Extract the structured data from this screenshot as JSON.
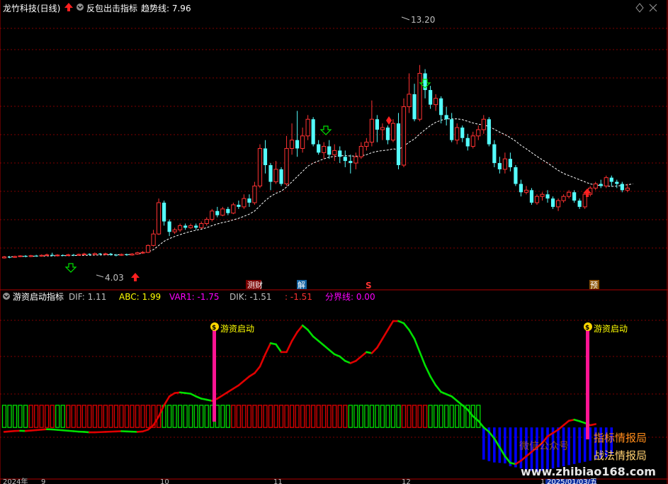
{
  "colors": {
    "up": "#ff3232",
    "down": "#54fcfc",
    "grid": "#800000",
    "border": "#b00000",
    "ma": "#ffffff",
    "green": "#00e000",
    "red": "#e00000",
    "blue": "#0000ff",
    "magenta": "#ff00ff",
    "yellow": "#ffff00",
    "label": "#c0c0c0",
    "watermark": "#ff8c1a"
  },
  "price_panel": {
    "stock_title": "龙竹科技(日线)",
    "indicator_name": "反包出击指标",
    "trend_label": "趋势线: 7.96",
    "max_label": "13.20",
    "min_label": "4.03",
    "markers": [
      "测财",
      "解",
      "S",
      "预"
    ]
  },
  "chart_data": {
    "type": "candlestick",
    "ylim": [
      3,
      15.5
    ],
    "max_price": 13.2,
    "min_price": 4.03,
    "trend_value": 7.96,
    "candles": [
      [
        3.95,
        4.0,
        3.92,
        4.05
      ],
      [
        4.0,
        3.98,
        3.94,
        4.04
      ],
      [
        3.98,
        4.02,
        3.95,
        4.06
      ],
      [
        4.02,
        4.05,
        3.99,
        4.08
      ],
      [
        4.05,
        4.02,
        3.98,
        4.09
      ],
      [
        4.02,
        4.06,
        3.99,
        4.1
      ],
      [
        4.06,
        4.04,
        4.0,
        4.1
      ],
      [
        4.04,
        4.08,
        4.01,
        4.12
      ],
      [
        4.08,
        4.1,
        4.04,
        4.16
      ],
      [
        4.1,
        4.06,
        4.03,
        4.2
      ],
      [
        4.06,
        4.09,
        4.02,
        4.13
      ],
      [
        4.09,
        4.07,
        4.03,
        4.12
      ],
      [
        4.07,
        4.1,
        4.04,
        4.15
      ],
      [
        4.1,
        4.08,
        4.04,
        4.14
      ],
      [
        4.08,
        4.12,
        4.05,
        4.16
      ],
      [
        4.12,
        4.14,
        4.08,
        4.2
      ],
      [
        4.14,
        4.11,
        4.07,
        4.17
      ],
      [
        4.11,
        4.16,
        4.09,
        4.21
      ],
      [
        4.16,
        4.13,
        4.08,
        4.19
      ],
      [
        4.13,
        4.15,
        4.09,
        4.2
      ],
      [
        4.15,
        4.1,
        4.06,
        4.19
      ],
      [
        4.1,
        4.08,
        4.03,
        4.14
      ],
      [
        4.08,
        4.12,
        4.05,
        4.16
      ],
      [
        4.12,
        4.09,
        4.05,
        4.16
      ],
      [
        4.09,
        4.14,
        4.06,
        4.18
      ],
      [
        4.14,
        4.2,
        4.1,
        4.25
      ],
      [
        4.2,
        4.22,
        4.15,
        4.28
      ],
      [
        4.22,
        4.55,
        4.18,
        4.6
      ],
      [
        4.55,
        5.1,
        4.5,
        5.3
      ],
      [
        5.1,
        6.6,
        5.05,
        6.8
      ],
      [
        6.6,
        5.7,
        5.5,
        6.7
      ],
      [
        5.7,
        5.2,
        5.0,
        5.8
      ],
      [
        5.2,
        5.3,
        5.1,
        5.4
      ],
      [
        5.3,
        5.5,
        5.2,
        5.6
      ],
      [
        5.5,
        5.4,
        5.3,
        5.6
      ],
      [
        5.4,
        5.5,
        5.35,
        5.6
      ],
      [
        5.5,
        5.4,
        5.3,
        5.6
      ],
      [
        5.4,
        5.6,
        5.35,
        5.7
      ],
      [
        5.6,
        5.8,
        5.5,
        5.9
      ],
      [
        5.8,
        6.2,
        5.7,
        6.3
      ],
      [
        6.2,
        6.0,
        5.9,
        6.4
      ],
      [
        6.0,
        6.3,
        5.95,
        6.4
      ],
      [
        6.3,
        6.1,
        6.0,
        6.4
      ],
      [
        6.1,
        6.5,
        6.05,
        6.6
      ],
      [
        6.5,
        6.4,
        6.3,
        6.7
      ],
      [
        6.4,
        6.8,
        6.3,
        7.0
      ],
      [
        6.8,
        6.6,
        6.4,
        7.0
      ],
      [
        6.6,
        7.4,
        6.5,
        7.6
      ],
      [
        7.4,
        9.2,
        7.3,
        9.4
      ],
      [
        9.2,
        8.4,
        8.0,
        9.6
      ],
      [
        8.4,
        7.6,
        7.2,
        8.5
      ],
      [
        7.6,
        8.2,
        7.5,
        8.6
      ],
      [
        8.2,
        7.5,
        7.4,
        8.3
      ],
      [
        7.5,
        9.2,
        7.4,
        9.8
      ],
      [
        9.2,
        9.6,
        8.9,
        10.4
      ],
      [
        9.6,
        9.2,
        8.8,
        11.0
      ],
      [
        9.2,
        9.8,
        9.0,
        10.2
      ],
      [
        9.8,
        10.6,
        9.6,
        10.8
      ],
      [
        10.6,
        9.4,
        9.3,
        10.7
      ],
      [
        9.4,
        9.0,
        8.9,
        9.6
      ],
      [
        9.0,
        9.3,
        8.7,
        9.5
      ],
      [
        9.3,
        8.9,
        8.7,
        9.6
      ],
      [
        8.9,
        9.1,
        8.6,
        9.4
      ],
      [
        9.1,
        8.8,
        8.5,
        9.3
      ],
      [
        8.8,
        8.6,
        8.3,
        9.1
      ],
      [
        8.6,
        8.5,
        8.0,
        8.9
      ],
      [
        8.5,
        8.8,
        8.2,
        9.0
      ],
      [
        8.8,
        9.3,
        8.7,
        9.5
      ],
      [
        9.3,
        9.5,
        9.1,
        9.7
      ],
      [
        9.5,
        10.6,
        9.3,
        11.5
      ],
      [
        10.6,
        10.1,
        9.5,
        10.8
      ],
      [
        10.1,
        10.2,
        9.6,
        10.4
      ],
      [
        10.2,
        9.6,
        9.4,
        10.3
      ],
      [
        9.6,
        10.4,
        9.5,
        10.6
      ],
      [
        10.4,
        8.4,
        8.2,
        10.9
      ],
      [
        8.4,
        11.2,
        8.3,
        11.6
      ],
      [
        11.2,
        11.8,
        10.9,
        12.8
      ],
      [
        11.8,
        10.6,
        10.5,
        12.3
      ],
      [
        10.6,
        12.8,
        10.5,
        13.2
      ],
      [
        12.8,
        12.0,
        11.6,
        13.0
      ],
      [
        12.0,
        11.3,
        11.1,
        12.2
      ],
      [
        11.3,
        11.6,
        11.0,
        11.8
      ],
      [
        11.6,
        10.8,
        10.4,
        11.7
      ],
      [
        10.8,
        10.6,
        10.3,
        11.2
      ],
      [
        10.6,
        9.6,
        9.5,
        10.9
      ],
      [
        9.6,
        10.2,
        9.4,
        10.4
      ],
      [
        10.2,
        9.7,
        9.5,
        10.3
      ],
      [
        9.7,
        9.3,
        9.1,
        9.9
      ],
      [
        9.3,
        9.8,
        9.2,
        10.0
      ],
      [
        9.8,
        10.1,
        9.6,
        10.3
      ],
      [
        10.1,
        10.6,
        9.9,
        10.8
      ],
      [
        10.6,
        9.4,
        9.3,
        10.7
      ],
      [
        9.4,
        8.5,
        8.3,
        9.6
      ],
      [
        8.5,
        8.2,
        8.0,
        8.8
      ],
      [
        8.2,
        8.7,
        8.0,
        9.0
      ],
      [
        8.7,
        8.3,
        8.1,
        9.0
      ],
      [
        8.3,
        7.5,
        7.4,
        8.4
      ],
      [
        7.5,
        7.1,
        6.9,
        7.7
      ],
      [
        7.1,
        7.2,
        7.0,
        7.4
      ],
      [
        7.2,
        6.6,
        6.5,
        7.3
      ],
      [
        6.6,
        6.9,
        6.5,
        7.0
      ],
      [
        6.9,
        7.0,
        6.7,
        7.1
      ],
      [
        7.0,
        6.8,
        6.6,
        7.2
      ],
      [
        6.8,
        6.4,
        6.3,
        6.9
      ],
      [
        6.4,
        6.7,
        6.2,
        6.8
      ],
      [
        6.7,
        6.9,
        6.6,
        7.0
      ],
      [
        6.9,
        7.1,
        6.8,
        7.2
      ],
      [
        7.1,
        6.7,
        6.6,
        7.2
      ],
      [
        6.7,
        6.4,
        6.3,
        6.8
      ],
      [
        6.4,
        7.0,
        6.3,
        7.1
      ],
      [
        7.0,
        7.3,
        6.9,
        7.4
      ],
      [
        7.3,
        7.5,
        7.2,
        7.6
      ],
      [
        7.5,
        7.4,
        7.3,
        7.7
      ],
      [
        7.4,
        7.8,
        7.3,
        7.9
      ],
      [
        7.8,
        7.6,
        7.4,
        7.9
      ],
      [
        7.6,
        7.5,
        7.3,
        7.7
      ],
      [
        7.5,
        7.2,
        7.1,
        7.6
      ],
      [
        7.2,
        7.3,
        7.1,
        7.5
      ]
    ],
    "trend_line": [
      4.0,
      4.01,
      4.01,
      4.02,
      4.03,
      4.03,
      4.04,
      4.04,
      4.05,
      4.05,
      4.06,
      4.06,
      4.06,
      4.07,
      4.07,
      4.08,
      4.08,
      4.09,
      4.09,
      4.1,
      4.1,
      4.1,
      4.11,
      4.11,
      4.12,
      4.14,
      4.18,
      4.24,
      4.35,
      4.55,
      4.75,
      4.88,
      4.98,
      5.07,
      5.15,
      5.22,
      5.28,
      5.33,
      5.4,
      5.5,
      5.58,
      5.65,
      5.7,
      5.78,
      5.85,
      5.95,
      6.05,
      6.2,
      6.45,
      6.7,
      6.9,
      7.05,
      7.15,
      7.35,
      7.6,
      7.85,
      8.1,
      8.35,
      8.5,
      8.6,
      8.7,
      8.78,
      8.82,
      8.85,
      8.86,
      8.84,
      8.83,
      8.85,
      8.9,
      9.0,
      9.06,
      9.1,
      9.12,
      9.18,
      9.15,
      9.3,
      9.5,
      9.65,
      9.9,
      10.1,
      10.3,
      10.45,
      10.55,
      10.62,
      10.62,
      10.62,
      10.58,
      10.5,
      10.42,
      10.36,
      10.33,
      10.25,
      10.12,
      9.98,
      9.86,
      9.72,
      9.55,
      9.35,
      9.18,
      9.0,
      8.82,
      8.66,
      8.5,
      8.32,
      8.15,
      8.0,
      7.9,
      7.8,
      7.7,
      7.6,
      7.5,
      7.45,
      7.42,
      7.4,
      7.38,
      7.4,
      7.43,
      7.46,
      7.5
    ]
  },
  "indicator": {
    "panel_title": "游资启动指标",
    "values": [
      {
        "text": "DIF: 1.11",
        "color": "#c0c0c0"
      },
      {
        "text": "ABC: 1.99",
        "color": "#ffff00"
      },
      {
        "text": "VAR1: -1.75",
        "color": "#ff00ff"
      },
      {
        "text": "DIK: -1.51",
        "color": "#c0c0c0"
      },
      {
        "text": ": -1.51",
        "color": "#ff3232"
      },
      {
        "text": "分界线: 0.00",
        "color": "#ff00ff"
      }
    ],
    "signal_label": "游资启动",
    "ylim": [
      -2.2,
      5.6
    ],
    "bars": [
      1,
      1,
      1,
      1,
      1,
      0,
      0,
      0,
      0,
      0,
      1,
      1,
      0,
      0,
      0,
      0,
      0,
      0,
      0,
      0,
      0,
      0,
      0,
      0,
      0,
      0,
      0,
      0,
      0,
      0,
      1,
      1,
      1,
      1,
      1,
      1,
      1,
      1,
      1,
      1,
      1,
      1,
      1,
      0,
      0,
      0,
      0,
      0,
      0,
      0,
      0,
      0,
      0,
      0,
      0,
      0,
      0,
      0,
      0,
      0,
      0,
      0,
      0,
      0,
      0,
      1,
      1,
      1,
      1,
      1,
      1,
      1,
      1,
      1,
      1,
      0,
      0,
      0,
      0,
      0,
      1,
      1,
      1,
      1,
      1,
      1,
      1,
      1,
      1,
      1,
      -1.45,
      -1.52,
      -1.58,
      -1.6,
      -1.62,
      -1.75,
      -1.8,
      -1.85,
      -1.9,
      -1.95,
      -2.0,
      -1.95,
      -1.9,
      -1.85,
      -1.8,
      -1.75,
      -1.7,
      -1.65,
      -1.6,
      -1.55,
      -1.5,
      -1.45,
      -1.4,
      -1.35,
      -1.2
    ],
    "line": [
      -0.2,
      -0.18,
      -0.16,
      -0.15,
      -0.16,
      -0.14,
      -0.12,
      -0.1,
      -0.08,
      -0.09,
      -0.11,
      -0.13,
      -0.15,
      -0.17,
      -0.19,
      -0.2,
      -0.22,
      -0.22,
      -0.21,
      -0.2,
      -0.19,
      -0.18,
      -0.17,
      -0.18,
      -0.19,
      -0.2,
      -0.18,
      -0.1,
      0.1,
      0.5,
      1.0,
      1.4,
      1.55,
      1.58,
      1.55,
      1.52,
      1.4,
      1.3,
      1.25,
      1.2,
      1.3,
      1.45,
      1.6,
      1.75,
      1.9,
      2.1,
      2.3,
      2.45,
      2.75,
      3.3,
      3.8,
      3.75,
      3.4,
      3.4,
      3.9,
      4.3,
      4.6,
      4.4,
      4.1,
      3.9,
      3.7,
      3.5,
      3.3,
      3.2,
      3.0,
      2.9,
      3.0,
      3.2,
      3.4,
      3.35,
      3.6,
      4.0,
      4.4,
      4.8,
      4.8,
      4.7,
      4.4,
      4.0,
      3.4,
      2.8,
      2.3,
      1.9,
      1.6,
      1.5,
      1.4,
      1.2,
      1.0,
      0.8,
      0.5,
      0.3,
      0.0,
      -0.2,
      -0.5,
      -0.9,
      -1.3,
      -1.6,
      -1.65,
      -1.5,
      -1.3,
      -1.1,
      -0.9,
      -0.7,
      -0.4,
      -0.25,
      -0.1,
      0.1,
      0.3,
      0.35,
      0.28,
      0.2,
      0.1,
      0.15
    ]
  },
  "dates": {
    "year_label": "2024年",
    "months": [
      "9",
      "10",
      "11",
      "12",
      "1"
    ],
    "cursor_date": "2025/01/03/五"
  },
  "watermark": {
    "line1": "指标情报局",
    "line2": "战法情报局",
    "line3": "微信公众号",
    "site": "www.zhibiao168.com"
  },
  "icons": [
    "up-arrow-icon",
    "down-arrow-icon",
    "settings-circle-icon",
    "diamond-icon",
    "close-icon",
    "money-bag-icon"
  ]
}
